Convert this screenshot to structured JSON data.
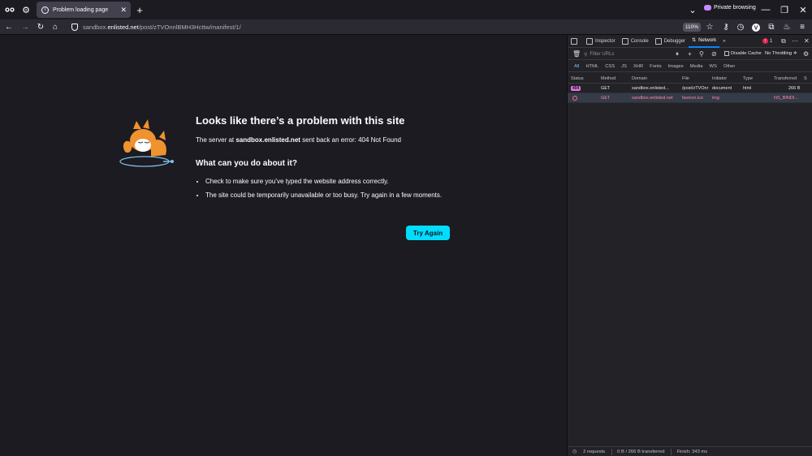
{
  "tab": {
    "title": "Problem loading page",
    "close": "✕",
    "new_tab": "+"
  },
  "browser": {
    "private_label": "Private browsing",
    "zoom": "110%"
  },
  "url": {
    "host": "sandbox.enlisted.net",
    "path": "/post/zTVOnnlBMH3Hcttw/manifest/1/",
    "prefix": "sandbox."
  },
  "error": {
    "title": "Looks like there’s a problem with this site",
    "desc_prefix": "The server at ",
    "desc_host": "sandbox.enlisted.net",
    "desc_suffix": " sent back an error: 404 Not Found",
    "subtitle": "What can you do about it?",
    "tips": [
      "Check to make sure you’ve typed the website address correctly.",
      "The site could be temporarily unavailable or too busy. Try again in a few moments."
    ],
    "button": "Try Again"
  },
  "devtools": {
    "tabs": [
      "Inspector",
      "Console",
      "Debugger",
      "Network"
    ],
    "error_count": "1",
    "filter_placeholder": "Filter URLs",
    "disable_cache": "Disable Cache",
    "throttling": "No Throttling ≑",
    "types": [
      "All",
      "HTML",
      "CSS",
      "JS",
      "XHR",
      "Fonts",
      "Images",
      "Media",
      "WS",
      "Other"
    ],
    "columns": [
      "Status",
      "Method",
      "Domain",
      "File",
      "Initiator",
      "Type",
      "Transferred",
      "S"
    ],
    "rows": [
      {
        "status": "404",
        "method": "GET",
        "domain": "sandbox.enlisted...",
        "file": "/post/zTVOnr",
        "initiator": "document",
        "type": "html",
        "transferred": "266 B"
      },
      {
        "status": "",
        "method": "GET",
        "domain": "sandbox.enlisted.net",
        "file": "favicon.ico",
        "initiator": "img",
        "type": "",
        "transferred": "NS_BINDI..."
      }
    ],
    "status_requests": "2 requests",
    "status_transferred": "0 B / 266 B transferred",
    "status_finish": "Finish: 343 ms"
  }
}
